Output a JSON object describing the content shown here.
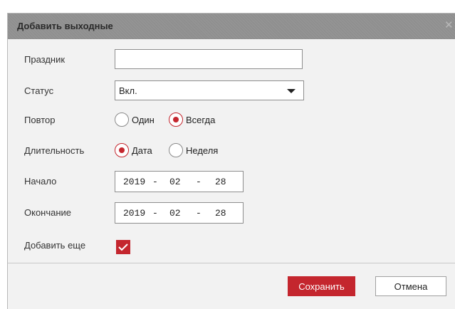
{
  "dialog": {
    "title": "Добавить выходные",
    "close_icon": "close-icon"
  },
  "form": {
    "holiday": {
      "label": "Праздник",
      "value": "",
      "placeholder": ""
    },
    "status": {
      "label": "Статус",
      "value": "Вкл.",
      "icon": "chevron-down-icon"
    },
    "repeat": {
      "label": "Повтор",
      "options": [
        {
          "label": "Один",
          "checked": false
        },
        {
          "label": "Всегда",
          "checked": true
        }
      ]
    },
    "duration": {
      "label": "Длительность",
      "options": [
        {
          "label": "Дата",
          "checked": true
        },
        {
          "label": "Неделя",
          "checked": false
        }
      ]
    },
    "start": {
      "label": "Начало",
      "year": "2019",
      "month": "02",
      "day": "28",
      "separator": "-"
    },
    "end": {
      "label": "Окончание",
      "year": "2019",
      "month": "02",
      "day": "28",
      "separator": "-"
    },
    "add_more": {
      "label": "Добавить еще",
      "checked": true
    }
  },
  "footer": {
    "save_label": "Сохранить",
    "cancel_label": "Отмена"
  },
  "colors": {
    "accent": "#c4262e",
    "titlebar": "#8f8f8f",
    "dialog_bg": "#f2f2f2"
  }
}
